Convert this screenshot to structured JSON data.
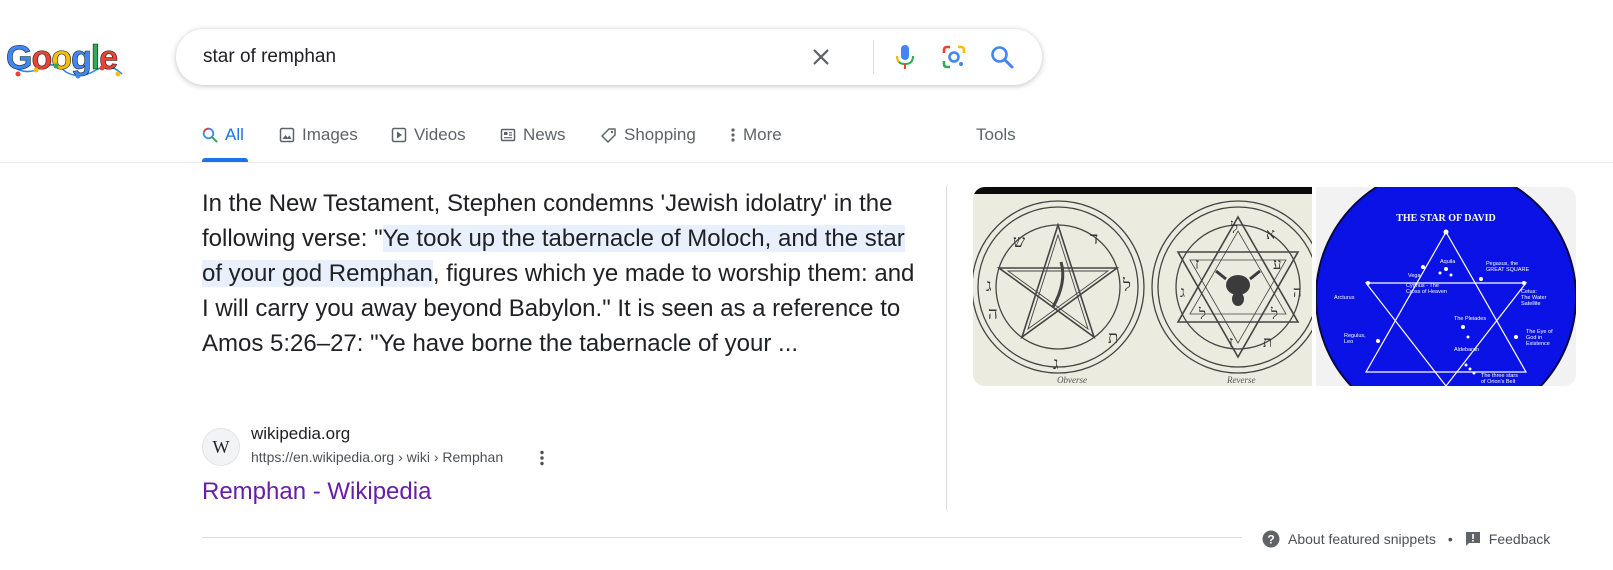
{
  "logo": {
    "text": "Google"
  },
  "search": {
    "query": "star of remphan",
    "icons": [
      "clear-icon",
      "mic-icon",
      "lens-icon",
      "search-icon"
    ]
  },
  "tabs": [
    {
      "label": "All",
      "icon": "search-icon",
      "active": true
    },
    {
      "label": "Images",
      "icon": "image-icon"
    },
    {
      "label": "Videos",
      "icon": "video-icon"
    },
    {
      "label": "News",
      "icon": "news-icon"
    },
    {
      "label": "Shopping",
      "icon": "tag-icon"
    },
    {
      "label": "More",
      "icon": "more-vert-icon"
    }
  ],
  "tools_label": "Tools",
  "snippet": {
    "text_before": "In the New Testament, Stephen condemns 'Jewish idolatry' in the following verse: \"",
    "highlight": "Ye took up the tabernacle of Moloch, and the star of your god Remphan",
    "text_after": ", figures which ye made to worship them: and I will carry you away beyond Babylon.\" It is seen as a reference to Amos 5:26–27: \"Ye have borne the tabernacle of your ..."
  },
  "images": {
    "thumb1": {
      "left_caption": "Obverse",
      "right_caption": "Reverse"
    },
    "thumb2": {
      "title": "THE STAR OF DAVID",
      "labels": [
        "Aquila",
        "Vega",
        "Pegasus, the GREAT SQUARE",
        "Arcturus",
        "Cygnus - The Cross of Heaven",
        "Cetus: The Water Satellite",
        "Regulus, Leo",
        "The Pleiades",
        "The Eye of God in Existence",
        "Aldebaran",
        "The three stars of Orion's Belt"
      ]
    }
  },
  "source": {
    "badge": "W",
    "site": "wikipedia.org",
    "url": "https://en.wikipedia.org › wiki › Remphan",
    "title": "Remphan - Wikipedia"
  },
  "footer": {
    "about": "About featured snippets",
    "separator": "•",
    "feedback": "Feedback"
  },
  "colors": {
    "accent": "#1a73e8",
    "visited_link": "#681da8",
    "highlight": "#e8f0fe",
    "thumb2_bg": "#0a12e6"
  }
}
